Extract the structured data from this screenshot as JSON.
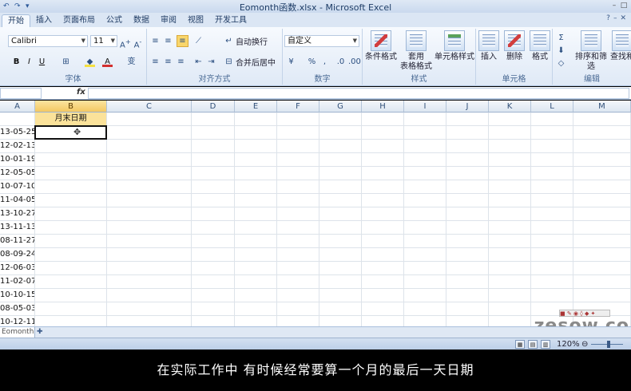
{
  "window": {
    "title": "Eomonth函数.xlsx - Microsoft Excel"
  },
  "tabs": [
    "开始",
    "插入",
    "页面布局",
    "公式",
    "数据",
    "审阅",
    "视图",
    "开发工具"
  ],
  "ribbon": {
    "font_name": "Calibri",
    "font_size": "11",
    "wrap_text": "自动换行",
    "merge_center": "合并后居中",
    "number_format": "自定义",
    "conditional_format": "条件格式",
    "table_format_1": "套用",
    "table_format_2": "表格格式",
    "cell_styles": "单元格样式",
    "insert": "插入",
    "delete": "删除",
    "format": "格式",
    "sort_filter": "排序和筛选",
    "find_select": "查找和",
    "group_labels": {
      "font": "字体",
      "alignment": "对齐方式",
      "number": "数字",
      "styles": "样式",
      "cells": "单元格",
      "editing": "编辑"
    }
  },
  "formula_bar": {
    "fx": "fx"
  },
  "columns": [
    "A",
    "B",
    "C",
    "D",
    "E",
    "F",
    "G",
    "H",
    "I",
    "J",
    "K",
    "L",
    "M"
  ],
  "header_b1": "月末日期",
  "dates": [
    "13-05-25",
    "12-02-13",
    "10-01-19",
    "12-05-05",
    "10-07-10",
    "11-04-05",
    "13-10-27",
    "13-11-13",
    "08-11-27",
    "08-09-24",
    "12-06-03",
    "11-02-07",
    "10-10-15",
    "08-05-03",
    "10-12-11"
  ],
  "sheet_tab": "Eomonth",
  "status": {
    "zoom": "120%"
  },
  "watermark": "zesow.co",
  "subtitle": "在实际工作中  有时候经常要算一个月的最后一天日期"
}
